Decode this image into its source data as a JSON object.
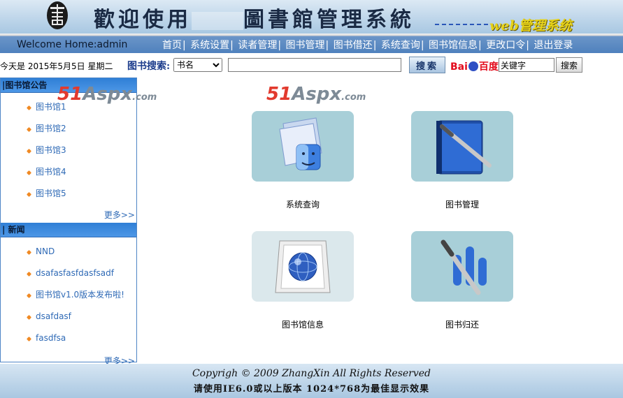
{
  "header": {
    "title_left": "歡迎使用",
    "title_right": "圖書館管理系統",
    "subtitle": "web管理系统"
  },
  "nav": {
    "welcome": "Welcome Home:admin",
    "items": [
      "首页",
      "系统设置",
      "读者管理",
      "图书管理",
      "图书借还",
      "系统查询",
      "图书馆信息",
      "更改口令",
      "退出登录"
    ]
  },
  "toolbar": {
    "date": "今天是  2015年5月5日 星期二",
    "search_label": "图书搜索:",
    "search_field_selected": "书名",
    "search_button": "搜索",
    "baidu_bai": "Bai",
    "baidu_du": "百度",
    "baidu_placeholder": "关键字",
    "baidu_button": "搜索"
  },
  "sidebar": {
    "notice": {
      "title": "|图书馆公告",
      "items": [
        "图书馆1",
        "图书馆2",
        "图书馆3",
        "图书馆4",
        "图书馆5"
      ],
      "more": "更多>>"
    },
    "news": {
      "title": "| 新闻",
      "items": [
        "NND",
        "dsafasfasfdasfsadf",
        "图书馆v1.0版本发布啦!",
        "dsafdasf",
        "fasdfsa"
      ],
      "more": "更多>>"
    }
  },
  "watermark": {
    "num": "51",
    "word": "Aspx",
    "domain": ".com"
  },
  "main": {
    "tiles": [
      {
        "label": "系统查询",
        "icon": "finder-icon"
      },
      {
        "label": "图书管理",
        "icon": "book-pen-icon"
      },
      {
        "label": "图书馆信息",
        "icon": "globe-icon"
      },
      {
        "label": "图书归还",
        "icon": "pen-icon"
      }
    ]
  },
  "footer": {
    "copyright": "Copyrigh © 2009 ZhangXin     All Rights Reserved",
    "tip": "请使用IE6.0或以上版本  1024*768为最佳显示效果"
  }
}
